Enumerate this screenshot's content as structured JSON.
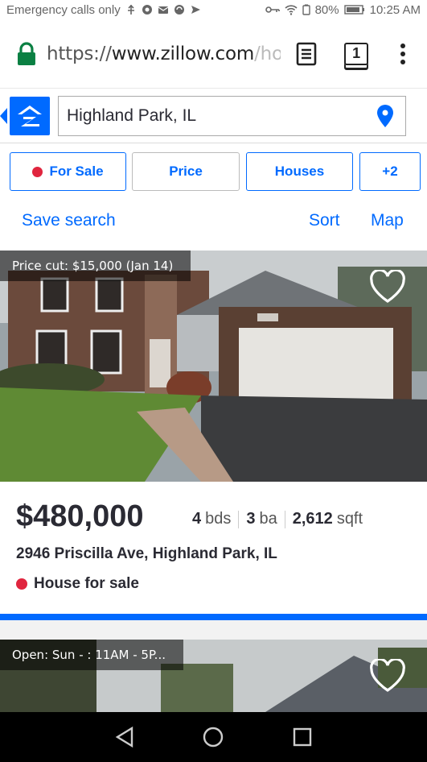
{
  "status_bar": {
    "left_text": "Emergency calls only",
    "battery": "80%",
    "time": "10:25 AM"
  },
  "browser": {
    "url_scheme": "https://",
    "url_host": "www.zillow.com",
    "url_path": "/ho",
    "tab_count": "1",
    "icons": [
      "lock-icon",
      "reader-mode-icon",
      "tabs-icon",
      "overflow-menu-icon"
    ]
  },
  "header": {
    "search_value": "Highland Park, IL",
    "icons": [
      "back-icon",
      "zillow-logo",
      "location-pin-icon"
    ]
  },
  "filters": {
    "for_sale": "For Sale",
    "price": "Price",
    "houses": "Houses",
    "more": "+2"
  },
  "actions": {
    "save_search": "Save search",
    "sort": "Sort",
    "map": "Map"
  },
  "listings": [
    {
      "tag": "Price cut: $15,000 (Jan 14)",
      "price": "$480,000",
      "beds": "4",
      "beds_unit": "bds",
      "baths": "3",
      "baths_unit": "ba",
      "sqft": "2,612",
      "sqft_unit": "sqft",
      "address": "2946 Priscilla Ave, Highland Park, IL",
      "status": "House for sale"
    },
    {
      "tag": "Open: Sun - : 11AM - 5P..."
    }
  ],
  "colors": {
    "accent": "#006aff",
    "status_red": "#e0253e",
    "text": "#2a2a33"
  }
}
